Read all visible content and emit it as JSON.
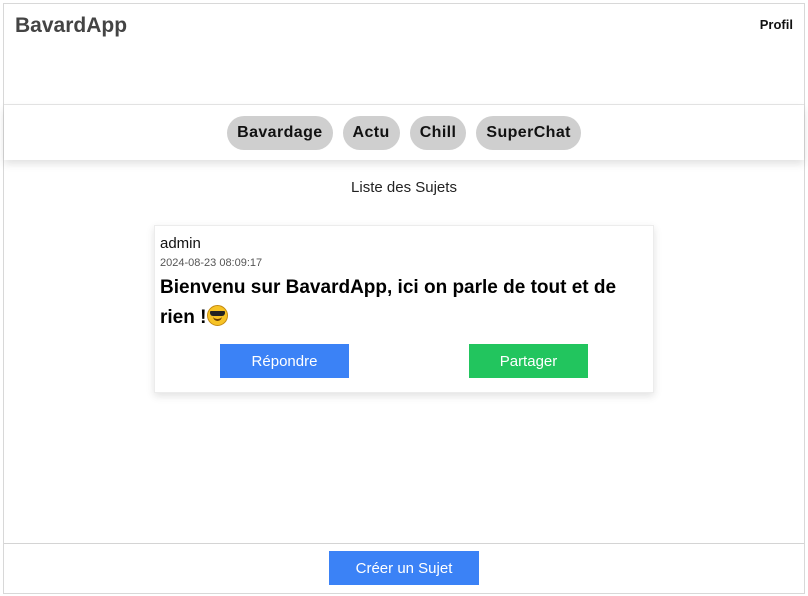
{
  "header": {
    "brand": "BavardApp",
    "profile_link": "Profil"
  },
  "nav": {
    "categories": [
      {
        "label": "Bavardage"
      },
      {
        "label": "Actu"
      },
      {
        "label": "Chill"
      },
      {
        "label": "SuperChat"
      }
    ]
  },
  "main": {
    "section_title": "Liste des Sujets",
    "topics": [
      {
        "author": "admin",
        "date": "2024-08-23 08:09:17",
        "message": "Bienvenu sur BavardApp, ici on parle de tout et de rien !",
        "emoji": "smiling-face-with-sunglasses-icon",
        "reply_label": "Répondre",
        "share_label": "Partager"
      }
    ]
  },
  "footer": {
    "create_label": "Créer un Sujet"
  },
  "colors": {
    "primary_button": "#3b82f6",
    "share_button": "#22c55e",
    "chip_background": "#cfcfcf",
    "brand_text": "#444444"
  }
}
